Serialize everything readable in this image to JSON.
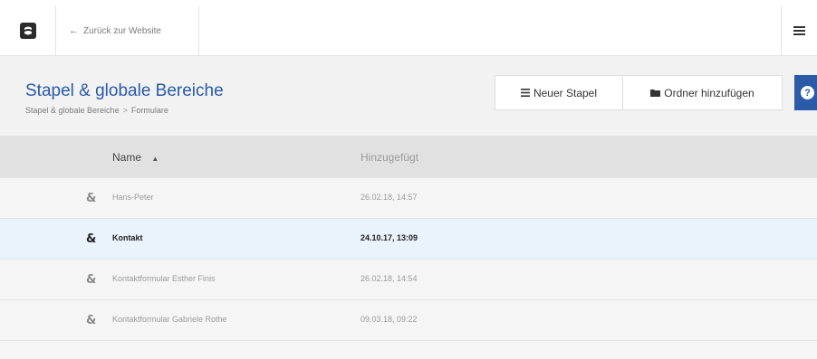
{
  "topbar": {
    "back_link": "Zurück zur Website"
  },
  "header": {
    "title": "Stapel & globale Bereiche",
    "breadcrumb": [
      "Stapel & globale Bereiche",
      "Formulare"
    ],
    "breadcrumb_separator": ">",
    "buttons": {
      "new_stack": "Neuer Stapel",
      "add_folder": "Ordner hinzufügen"
    },
    "help_label": "?"
  },
  "table": {
    "columns": {
      "name": "Name",
      "added": "Hinzugefügt"
    },
    "rows": [
      {
        "name": "Hans-Peter",
        "added": "26.02.18, 14:57",
        "selected": false
      },
      {
        "name": "Kontakt",
        "added": "24.10.17, 13:09",
        "selected": true
      },
      {
        "name": "Kontaktformular Esther Finis",
        "added": "26.02.18, 14:54",
        "selected": false
      },
      {
        "name": "Kontaktformular Gabriele Rothe",
        "added": "09.03.18, 09:22",
        "selected": false
      }
    ]
  },
  "colors": {
    "accent": "#2a5aa8",
    "selected_row": "#e9f3fb",
    "header_row": "#e1e1e1"
  }
}
